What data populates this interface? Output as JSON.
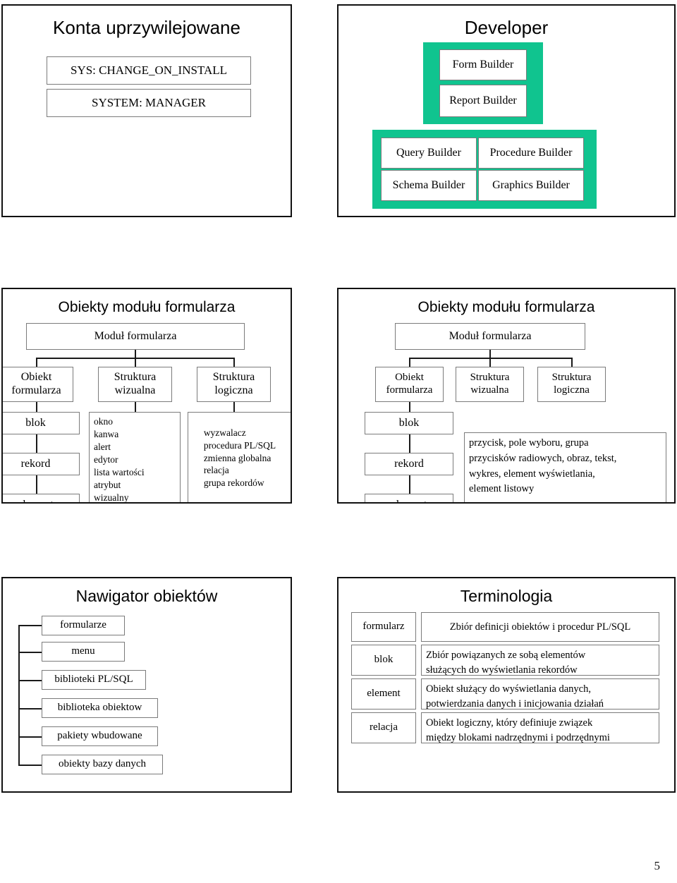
{
  "page_number": "5",
  "accent_green": "#10c48f",
  "slides": {
    "privileged_accounts": {
      "title": "Konta uprzywilejowane",
      "accounts": [
        "SYS: CHANGE_ON_INSTALL",
        "SYSTEM: MANAGER"
      ]
    },
    "developer": {
      "title": "Developer",
      "top_group": [
        "Form  Builder",
        "Report  Builder"
      ],
      "bottom_group": [
        "Query  Builder",
        "Procedure  Builder",
        "Schema  Builder",
        "Graphics  Builder"
      ]
    },
    "form_module_objects_1": {
      "title": "Obiekty modułu formularza",
      "root": "Moduł  formularza",
      "branches": [
        "Obiekt\nformularza",
        "Struktura\nwizualna",
        "Struktura\nlogiczna"
      ],
      "branch_lines": [
        [
          "Obiekt",
          "formularza"
        ],
        [
          "Struktura",
          "wizualna"
        ],
        [
          "Struktura",
          "logiczna"
        ]
      ],
      "object_chain": [
        "blok",
        "rekord",
        "element"
      ],
      "visual_list": "okno\nkanwa\nalert\nedytor\nlista  wartości\natrybut\nwizualny",
      "logical_list": "wyzwalacz\nprocedura  PL/SQL\nzmienna  globalna\nrelacja\ngrupa  rekordów"
    },
    "form_module_objects_2": {
      "title": "Obiekty modułu formularza",
      "root": "Moduł  formularza",
      "branch_lines": [
        [
          "Obiekt",
          "formularza"
        ],
        [
          "Struktura",
          "wizualna"
        ],
        [
          "Struktura",
          "logiczna"
        ]
      ],
      "object_chain": [
        "blok",
        "rekord",
        "element"
      ],
      "element_types": "przycisk, pole  wyboru,  grupa\nprzycisków  radiowych,  obraz,  tekst,\nwykres,  element  wyświetlania,\nelement  listowy"
    },
    "object_navigator": {
      "title": "Nawigator obiektów",
      "items": [
        "formularze",
        "menu",
        "biblioteki  PL/SQL",
        "biblioteka  obiektow",
        "pakiety  wbudowane",
        "obiekty  bazy  danych"
      ]
    },
    "terminology": {
      "title": "Terminologia",
      "rows": [
        {
          "term": "formularz",
          "definition": "Zbiór  definicji  obiektów  i  procedur  PL/SQL"
        },
        {
          "term": "blok",
          "definition": "Zbiór  powiązanych  ze  sobą  elementów\nsłużących  do  wyświetlania  rekordów"
        },
        {
          "term": "element",
          "definition": "Obiekt  służący  do  wyświetlania  danych,\npotwierdzania  danych  i  inicjowania  działań"
        },
        {
          "term": "relacja",
          "definition": "Obiekt  logiczny,  który  definiuje  związek\nmiędzy  blokami  nadrzędnymi  i  podrzędnymi"
        }
      ]
    }
  }
}
